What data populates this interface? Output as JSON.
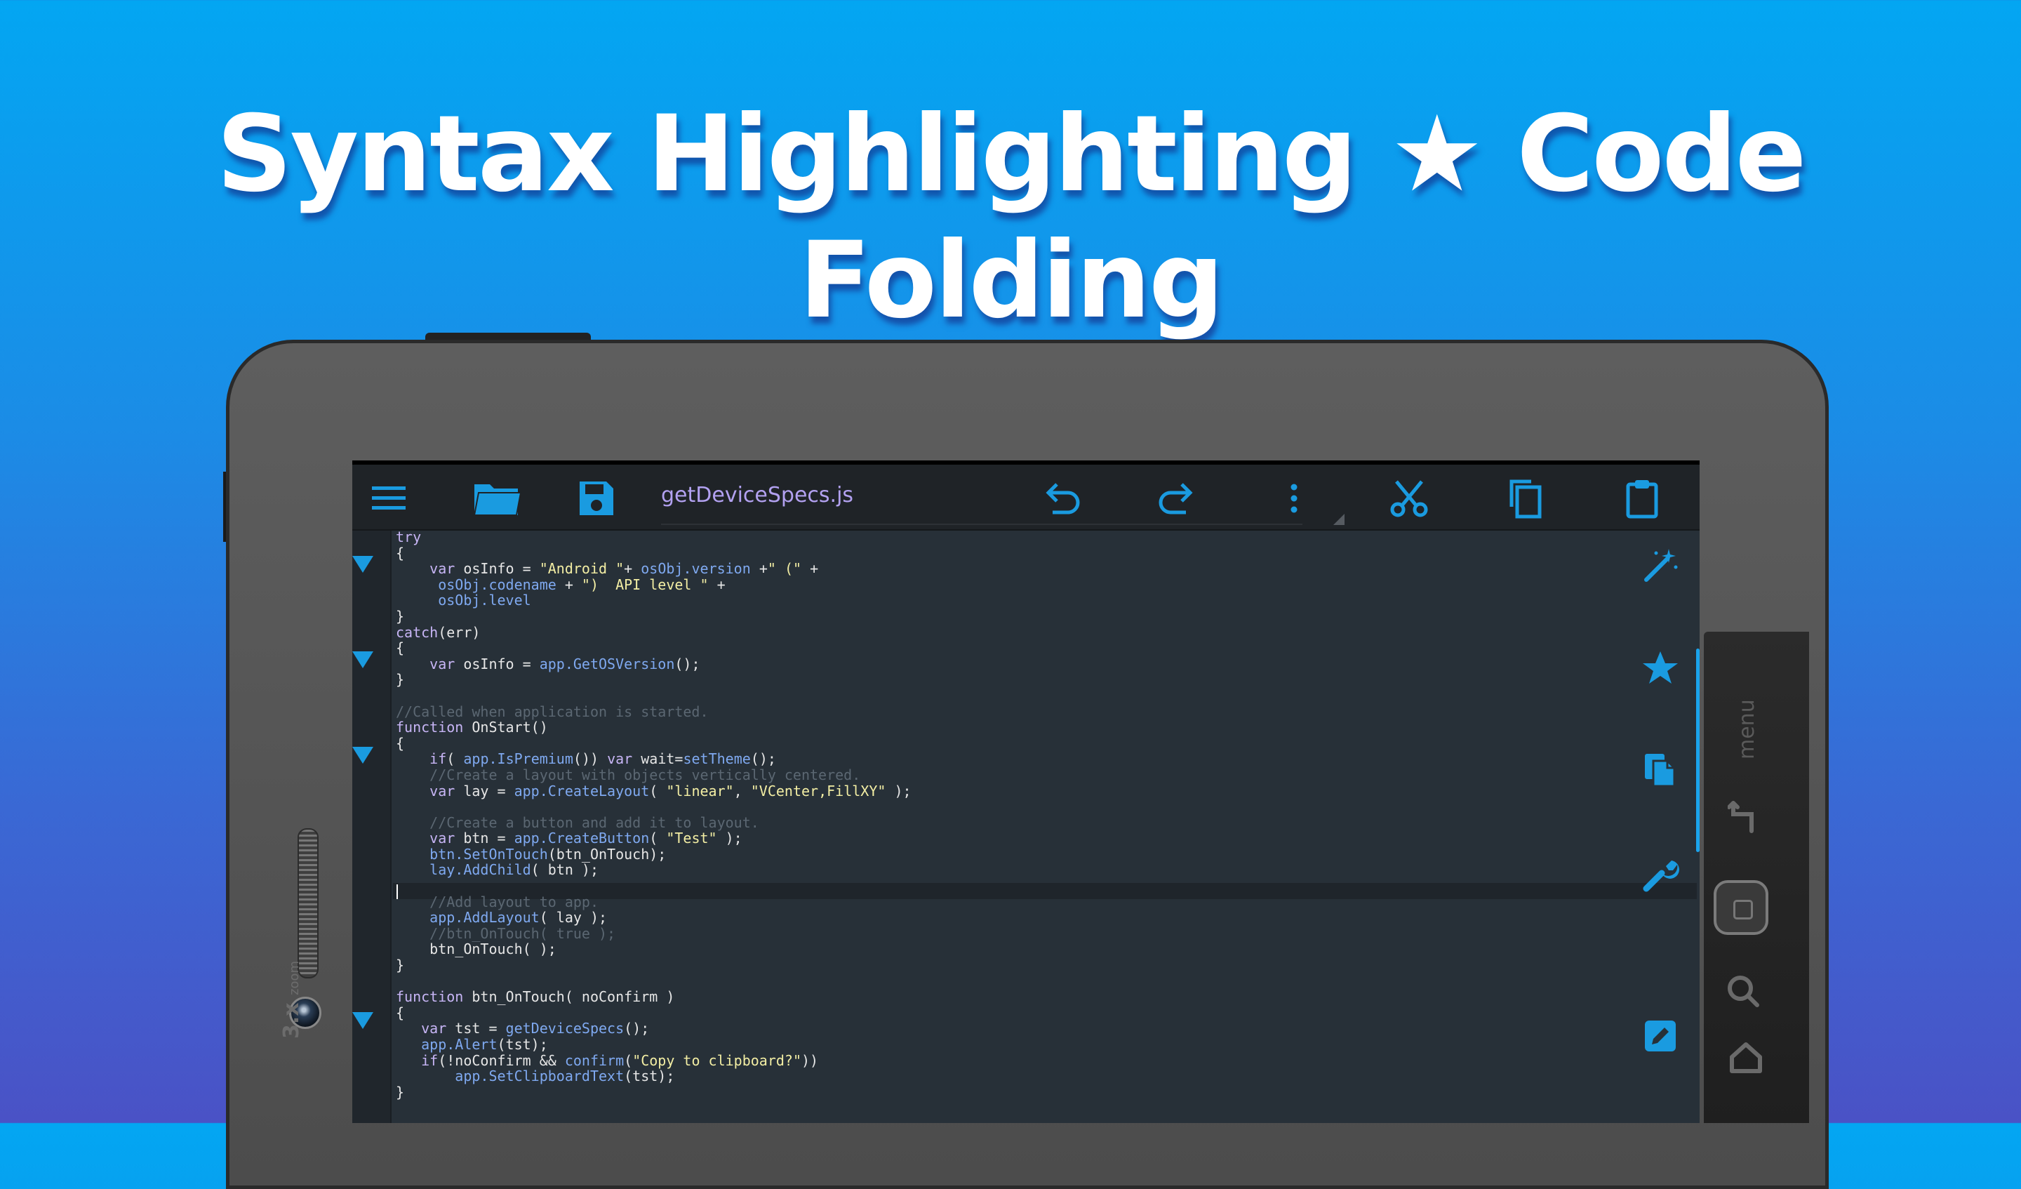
{
  "headline": "Syntax Highlighting ★ Code Folding",
  "device": {
    "zoom_label": "3.x",
    "zoom_small": "zoom",
    "menu_label": "menu"
  },
  "toolbar": {
    "filename": "getDeviceSpecs.js",
    "icons": [
      "menu-icon",
      "folder-icon",
      "save-icon",
      "undo-icon",
      "redo-icon",
      "more-vert-icon",
      "cut-icon",
      "copy-icon",
      "paste-icon"
    ]
  },
  "side_tools": [
    "magic-wand-icon",
    "star-icon",
    "copy-file-icon",
    "wrench-icon",
    "edit-icon"
  ],
  "colors": {
    "accent": "#1a9be0",
    "keyword": "#c7b5f5",
    "member": "#7fa9f0",
    "string": "#f3eea4",
    "comment": "#5b6772",
    "editor_bg": "#273038"
  },
  "code_lines": [
    [
      [
        "k",
        "try"
      ]
    ],
    [
      [
        "t",
        "{"
      ]
    ],
    [
      [
        "t",
        "    "
      ],
      [
        "k",
        "var"
      ],
      [
        "t",
        " osInfo = "
      ],
      [
        "s",
        "\"Android \""
      ],
      [
        "t",
        "+ "
      ],
      [
        "m",
        "osObj.version"
      ],
      [
        "t",
        " +"
      ],
      [
        "s",
        "\" (\""
      ],
      [
        "t",
        " +"
      ]
    ],
    [
      [
        "t",
        "     "
      ],
      [
        "m",
        "osObj.codename"
      ],
      [
        "t",
        " + "
      ],
      [
        "s",
        "\")  API level \""
      ],
      [
        "t",
        " +"
      ]
    ],
    [
      [
        "t",
        "     "
      ],
      [
        "m",
        "osObj.level"
      ]
    ],
    [
      [
        "t",
        "}"
      ]
    ],
    [
      [
        "k",
        "catch"
      ],
      [
        "t",
        "(err)"
      ]
    ],
    [
      [
        "t",
        "{"
      ]
    ],
    [
      [
        "t",
        "    "
      ],
      [
        "k",
        "var"
      ],
      [
        "t",
        " osInfo = "
      ],
      [
        "m",
        "app.GetOSVersion"
      ],
      [
        "t",
        "();"
      ]
    ],
    [
      [
        "t",
        "}"
      ]
    ],
    [
      [
        "t",
        ""
      ]
    ],
    [
      [
        "c",
        "//Called when application is started."
      ]
    ],
    [
      [
        "k",
        "function"
      ],
      [
        "t",
        " OnStart()"
      ]
    ],
    [
      [
        "t",
        "{"
      ]
    ],
    [
      [
        "t",
        "    "
      ],
      [
        "k",
        "if"
      ],
      [
        "t",
        "( "
      ],
      [
        "m",
        "app.IsPremium"
      ],
      [
        "t",
        "()) "
      ],
      [
        "k",
        "var"
      ],
      [
        "t",
        " wait="
      ],
      [
        "m",
        "setTheme"
      ],
      [
        "t",
        "();"
      ]
    ],
    [
      [
        "t",
        "    "
      ],
      [
        "c",
        "//Create a layout with objects vertically centered."
      ]
    ],
    [
      [
        "t",
        "    "
      ],
      [
        "k",
        "var"
      ],
      [
        "t",
        " lay = "
      ],
      [
        "m",
        "app.CreateLayout"
      ],
      [
        "t",
        "( "
      ],
      [
        "s",
        "\"linear\""
      ],
      [
        "t",
        ", "
      ],
      [
        "s",
        "\"VCenter,FillXY\""
      ],
      [
        "t",
        " );"
      ]
    ],
    [
      [
        "t",
        ""
      ]
    ],
    [
      [
        "t",
        "    "
      ],
      [
        "c",
        "//Create a button and add it to layout."
      ]
    ],
    [
      [
        "t",
        "    "
      ],
      [
        "k",
        "var"
      ],
      [
        "t",
        " btn = "
      ],
      [
        "m",
        "app.CreateButton"
      ],
      [
        "t",
        "( "
      ],
      [
        "s",
        "\"Test\""
      ],
      [
        "t",
        " );"
      ]
    ],
    [
      [
        "t",
        "    "
      ],
      [
        "m",
        "btn.SetOnTouch"
      ],
      [
        "t",
        "(btn_OnTouch);"
      ]
    ],
    [
      [
        "t",
        "    "
      ],
      [
        "m",
        "lay.AddChild"
      ],
      [
        "t",
        "( btn );"
      ]
    ],
    [
      [
        "t",
        ""
      ]
    ],
    [
      [
        "t",
        "    "
      ],
      [
        "c",
        "//Add layout to app."
      ]
    ],
    [
      [
        "t",
        "    "
      ],
      [
        "m",
        "app.AddLayout"
      ],
      [
        "t",
        "( lay );"
      ]
    ],
    [
      [
        "t",
        "    "
      ],
      [
        "c",
        "//btn_OnTouch( true );"
      ]
    ],
    [
      [
        "t",
        "    btn_OnTouch( );"
      ]
    ],
    [
      [
        "t",
        "}"
      ]
    ],
    [
      [
        "t",
        ""
      ]
    ],
    [
      [
        "k",
        "function"
      ],
      [
        "t",
        " btn_OnTouch( noConfirm )"
      ]
    ],
    [
      [
        "t",
        "{"
      ]
    ],
    [
      [
        "t",
        "   "
      ],
      [
        "k",
        "var"
      ],
      [
        "t",
        " tst = "
      ],
      [
        "m",
        "getDeviceSpecs"
      ],
      [
        "t",
        "();"
      ]
    ],
    [
      [
        "t",
        "   "
      ],
      [
        "m",
        "app.Alert"
      ],
      [
        "t",
        "(tst);"
      ]
    ],
    [
      [
        "t",
        "   "
      ],
      [
        "k",
        "if"
      ],
      [
        "t",
        "(!noConfirm && "
      ],
      [
        "m",
        "confirm"
      ],
      [
        "t",
        "("
      ],
      [
        "s",
        "\"Copy to clipboard?\""
      ],
      [
        "t",
        "))"
      ]
    ],
    [
      [
        "t",
        "       "
      ],
      [
        "m",
        "app.SetClipboardText"
      ],
      [
        "t",
        "(tst);"
      ]
    ],
    [
      [
        "t",
        "}"
      ]
    ]
  ]
}
